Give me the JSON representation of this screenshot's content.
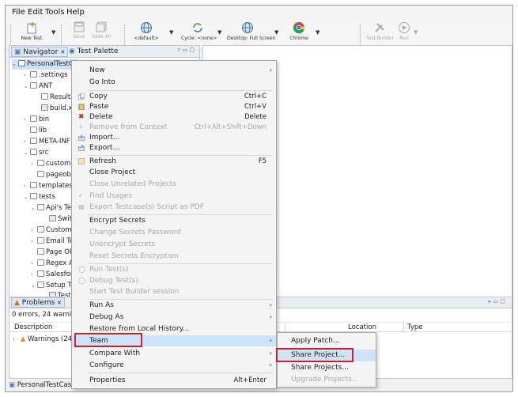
{
  "menubar": {
    "items": [
      "File",
      "Edit",
      "Tools",
      "Help"
    ]
  },
  "toolbar": {
    "new_test": "New Test",
    "save": "Save",
    "save_all": "Save All",
    "default": "<default>",
    "cycle": "Cycle: <none>",
    "desktop": "Desktop: Full Screen",
    "browser": "Chrome",
    "test_builder": "Test Builder",
    "run": "Run"
  },
  "navigator": {
    "tab_label": "Navigator",
    "tab2_label": "Test Palette",
    "rows": [
      "PersonalTestCas",
      ".settings",
      "ANT",
      "Results",
      "build.xml",
      "bin",
      "lib",
      "META-INF",
      "src",
      "customap",
      "pageobjec",
      "templates",
      "tests",
      "Api's Test",
      "Switch I",
      "Custom A",
      "Email Testi",
      "Page Obje",
      "Regex Api",
      "Salesforce",
      "Setup Test",
      "Test Cas"
    ]
  },
  "problems": {
    "tab_label": "Problems",
    "summary": "0 errors, 24 warning",
    "col_description": "Description",
    "col_location": "Location",
    "col_type": "Type",
    "warnings_row": "Warnings (24 it"
  },
  "status": {
    "project": "PersonalTestCases"
  },
  "context_menu": {
    "new": "New",
    "go_into": "Go Into",
    "copy": "Copy",
    "copy_sc": "Ctrl+C",
    "paste": "Paste",
    "paste_sc": "Ctrl+V",
    "delete": "Delete",
    "delete_sc": "Delete",
    "remove_ctx": "Remove from Context",
    "remove_ctx_sc": "Ctrl+Alt+Shift+Down",
    "import": "Import...",
    "export": "Export...",
    "refresh": "Refresh",
    "refresh_sc": "F5",
    "close_project": "Close Project",
    "close_unrelated": "Close Unrelated Projects",
    "find_usages": "Find Usages",
    "export_pdf": "Export Testcase(s) Script as PDF",
    "encrypt": "Encrypt Secrets",
    "change_pw": "Change Secrets Password",
    "unencrypt": "Unencrypt Secrets",
    "reset_enc": "Reset Secrets Encryption",
    "run_tests": "Run Test(s)",
    "debug_tests": "Debug Test(s)",
    "start_tb": "Start Test Builder session",
    "run_as": "Run As",
    "debug_as": "Debug As",
    "restore": "Restore from Local History...",
    "team": "Team",
    "compare": "Compare With",
    "configure": "Configure",
    "properties": "Properties",
    "properties_sc": "Alt+Enter"
  },
  "team_submenu": {
    "apply_patch": "Apply Patch...",
    "share_project": "Share Project...",
    "share_projects": "Share Projects...",
    "upgrade_projects": "Upgrade Projects..."
  },
  "colors": {
    "highlight": "#cde3fa",
    "callout": "#d21f2a"
  }
}
